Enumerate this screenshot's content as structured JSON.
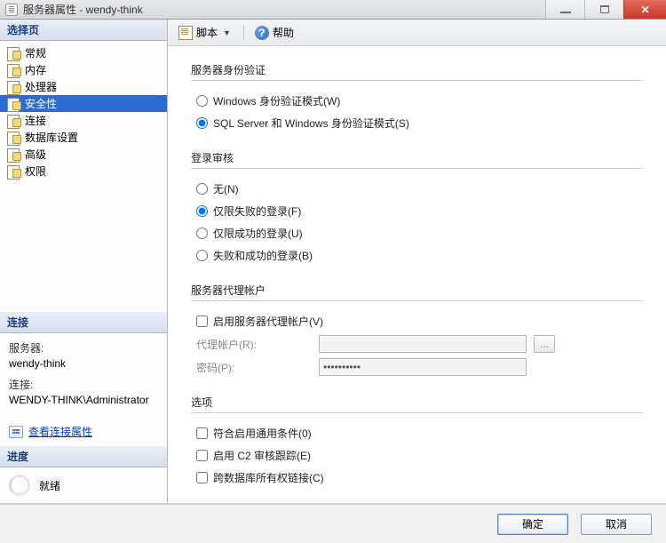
{
  "window": {
    "title": "服务器属性 - wendy-think"
  },
  "win_controls": {
    "min": "最小化",
    "max": "还原",
    "close": "关闭"
  },
  "left": {
    "select_page_header": "选择页",
    "pages": [
      {
        "id": "general",
        "label": "常规"
      },
      {
        "id": "memory",
        "label": "内存"
      },
      {
        "id": "cpu",
        "label": "处理器"
      },
      {
        "id": "security",
        "label": "安全性"
      },
      {
        "id": "connections",
        "label": "连接"
      },
      {
        "id": "dbsettings",
        "label": "数据库设置"
      },
      {
        "id": "advanced",
        "label": "高级"
      },
      {
        "id": "permissions",
        "label": "权限"
      }
    ],
    "selected_id": "security",
    "connection_header": "连接",
    "server_label": "服务器:",
    "server_value": "wendy-think",
    "conn_label": "连接:",
    "conn_value": "WENDY-THINK\\Administrator",
    "view_conn_props": "查看连接属性",
    "progress_header": "进度",
    "progress_status": "就绪"
  },
  "toolbar": {
    "script": "脚本",
    "help": "帮助"
  },
  "auth": {
    "title": "服务器身份验证",
    "options": [
      {
        "label": "Windows 身份验证模式(W)",
        "checked": false
      },
      {
        "label": "SQL Server 和 Windows 身份验证模式(S)",
        "checked": true
      }
    ]
  },
  "audit": {
    "title": "登录审核",
    "options": [
      {
        "label": "无(N)",
        "checked": false
      },
      {
        "label": "仅限失败的登录(F)",
        "checked": true
      },
      {
        "label": "仅限成功的登录(U)",
        "checked": false
      },
      {
        "label": "失败和成功的登录(B)",
        "checked": false
      }
    ]
  },
  "proxy": {
    "title": "服务器代理帐户",
    "enable_label": "启用服务器代理帐户(V)",
    "enable_checked": false,
    "account_label": "代理帐户(R):",
    "account_value": "",
    "browse_btn": "...",
    "password_label": "密码(P):",
    "password_value": "**********"
  },
  "options": {
    "title": "选项",
    "items": [
      {
        "label": "符合启用通用条件(0)",
        "checked": false
      },
      {
        "label": "启用 C2 审核跟踪(E)",
        "checked": false
      },
      {
        "label": "跨数据库所有权链接(C)",
        "checked": false
      }
    ]
  },
  "footer": {
    "ok": "确定",
    "cancel": "取消"
  }
}
